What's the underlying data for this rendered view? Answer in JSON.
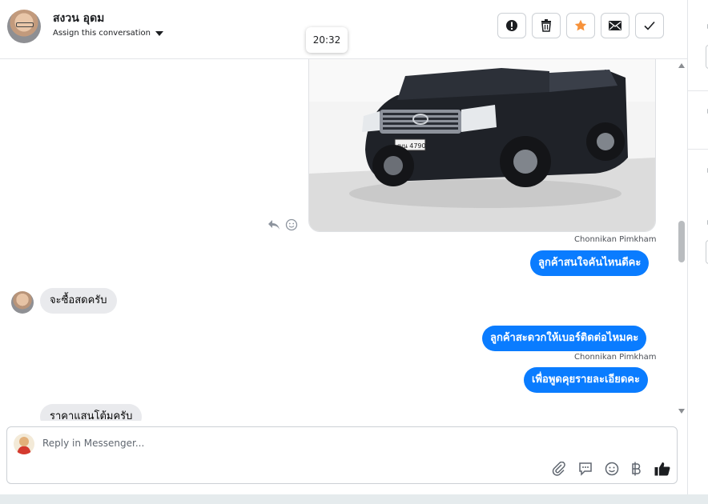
{
  "header": {
    "contact_name": "สงวน อุดม",
    "assign_label": "Assign this conversation",
    "tooltip_time": "20:32",
    "actions": [
      {
        "name": "mark-spam-button",
        "icon": "exclamation-icon"
      },
      {
        "name": "delete-button",
        "icon": "trash-icon"
      },
      {
        "name": "star-button",
        "icon": "star-icon"
      },
      {
        "name": "mark-unread-button",
        "icon": "envelope-icon"
      },
      {
        "name": "mark-done-button",
        "icon": "check-icon"
      }
    ],
    "star_color": "#f7923a"
  },
  "messages": [
    {
      "type": "image",
      "direction": "outgoing",
      "alt": "Black pickup truck",
      "plate": "ฒน 4790"
    },
    {
      "type": "sender",
      "text": "Chonnikan Pimkham"
    },
    {
      "type": "outgoing",
      "text": "ลูกค้าสนใจคันไหนดีคะ"
    },
    {
      "type": "incoming",
      "text": "จะซื้อสดครับ"
    },
    {
      "type": "outgoing",
      "text": "ลูกค้าสะดวกให้เบอร์ติดต่อไหมคะ"
    },
    {
      "type": "sender",
      "text": "Chonnikan Pimkham"
    },
    {
      "type": "outgoing",
      "text": "เพื่อพูดคุยรายละเอียดคะ"
    },
    {
      "type": "incoming",
      "text": "ราคาแสนโต้มครับ"
    }
  ],
  "composer": {
    "placeholder": "Reply in Messenger...",
    "tools": [
      "paperclip-icon",
      "saved-reply-icon",
      "emoji-icon",
      "baht-icon",
      "thumbs-up-icon"
    ]
  },
  "colors": {
    "outgoing_bubble": "#0a7cff",
    "incoming_bubble": "#e9eaed"
  }
}
